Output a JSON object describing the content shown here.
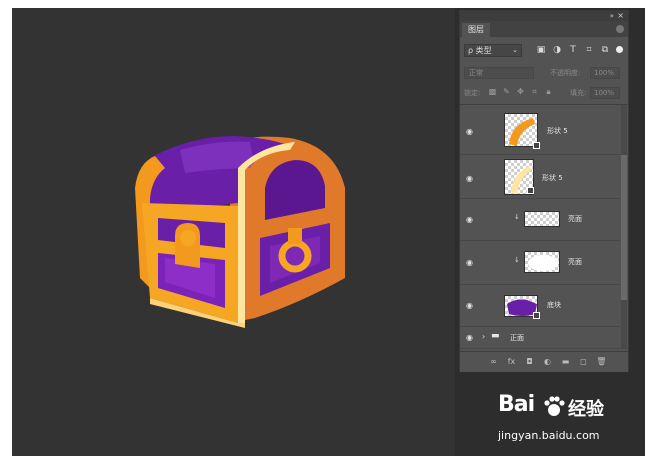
{
  "panel": {
    "tab_label": "图层",
    "filter_label": "ρ 类型",
    "blend_mode": "正常",
    "opacity_label": "不透明度:",
    "opacity_value": "100%",
    "lock_label": "锁定:",
    "fill_label": "填充:",
    "fill_value": "100%"
  },
  "layers": [
    {
      "name": "形状 5",
      "visible": true,
      "clipped": false,
      "thumb": "orange-arc"
    },
    {
      "name": "形状 5",
      "visible": true,
      "clipped": false,
      "thumb": "pale-arc"
    },
    {
      "name": "亮面",
      "visible": true,
      "clipped": true,
      "thumb": "transparent"
    },
    {
      "name": "亮面",
      "visible": true,
      "clipped": true,
      "thumb": "white-blob"
    },
    {
      "name": "底块",
      "visible": true,
      "clipped": false,
      "thumb": "purple-shape"
    },
    {
      "name": "正面",
      "visible": true,
      "clipped": false,
      "thumb": "group-folder"
    }
  ],
  "watermark": {
    "logo_text": "Bai",
    "logo_cn": "经验",
    "url": "jingyan.baidu.com"
  },
  "colors": {
    "chest_orange": "#f39a1e",
    "chest_purple": "#6a1fa8",
    "chest_side": "#e07a2a",
    "canvas_bg": "#333333",
    "panel_bg": "#535353"
  }
}
